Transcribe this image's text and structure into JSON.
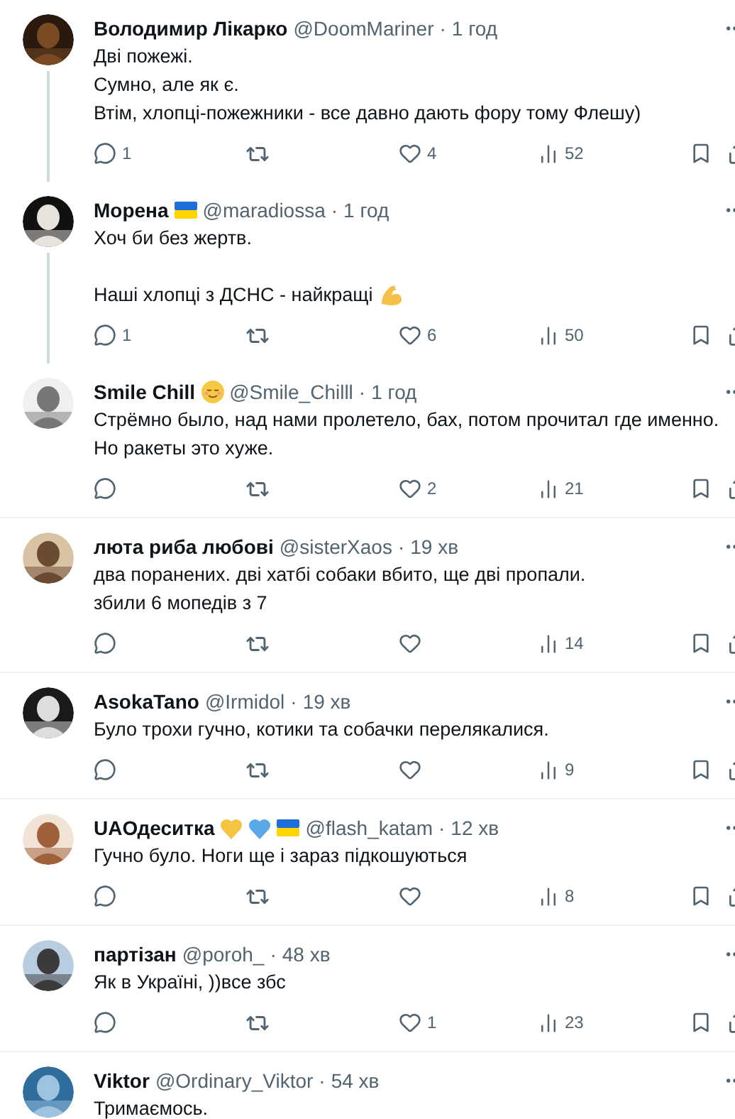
{
  "tweets": [
    {
      "name": "Володимир Лікарко",
      "handle": "@DoomMariner",
      "separator": "·",
      "time": "1 год",
      "thread": true,
      "paragraphs": [
        {
          "kind": "plain",
          "lines": [
            "Дві пожежі.",
            "Сумно, але як є.",
            "Втім, хлопці-пожежники - все давно дають фору тому Флешу)"
          ]
        }
      ],
      "actions": {
        "replies": "1",
        "likes": "4",
        "views": "52"
      }
    },
    {
      "name": "Морена",
      "badges": [
        {
          "kind": "flag"
        }
      ],
      "handle": "@maradiossa",
      "separator": "·",
      "time": "1 год",
      "thread": true,
      "paragraphs": [
        {
          "kind": "plain",
          "lines": [
            "Хоч би без жертв."
          ]
        },
        {
          "kind": "flexed_arm_end",
          "lines": [
            "Наші хлопці з ДСНС - найкращі"
          ]
        }
      ],
      "actions": {
        "replies": "1",
        "likes": "6",
        "views": "50"
      }
    },
    {
      "name": "Smile Chill",
      "badges": [
        {
          "kind": "smile"
        }
      ],
      "handle": "@Smile_Chilll",
      "separator": "·",
      "time": "1 год",
      "thread": false,
      "paragraphs": [
        {
          "kind": "plain",
          "lines": [
            "Стрёмно было, над нами пролетело, бах, потом прочитал где именно.",
            "Но ракеты это хуже."
          ]
        }
      ],
      "actions": {
        "likes": "2",
        "views": "21"
      }
    },
    {
      "name": "люта риба любові",
      "handle": "@sisterXaos",
      "separator": "·",
      "time": "19 хв",
      "thread": false,
      "paragraphs": [
        {
          "kind": "plain",
          "lines": [
            "два поранених. дві хатбі собаки вбито, ще дві пропали.",
            "збили 6 мопедів з 7"
          ]
        }
      ],
      "actions": {
        "views": "14"
      }
    },
    {
      "name": "AsokaTano",
      "handle": "@Irmidol",
      "separator": "·",
      "time": "19 хв",
      "thread": false,
      "paragraphs": [
        {
          "kind": "plain",
          "lines": [
            "Було трохи гучно, котики та собачки перелякалися."
          ]
        }
      ],
      "actions": {
        "views": "9"
      }
    },
    {
      "name": "UAОдеситка",
      "badges": [
        {
          "kind": "heart",
          "color": "#f5c542"
        },
        {
          "kind": "heart",
          "color": "#5aa9e6"
        },
        {
          "kind": "flag"
        }
      ],
      "handle": "@flash_katam",
      "separator": "·",
      "time": "12 хв",
      "thread": false,
      "paragraphs": [
        {
          "kind": "plain",
          "lines": [
            "Гучно було. Ноги ще і зараз підкошуються"
          ]
        }
      ],
      "actions": {
        "views": "8"
      }
    },
    {
      "name": "партізан",
      "handle": "@poroh_",
      "separator": "·",
      "time": "48 хв",
      "thread": false,
      "paragraphs": [
        {
          "kind": "plain",
          "lines": [
            "Як в Україні, ))все збс"
          ]
        }
      ],
      "actions": {
        "likes": "1",
        "views": "23"
      }
    },
    {
      "name": "Viktor",
      "handle": "@Ordinary_Viktor",
      "separator": "·",
      "time": "54 хв",
      "thread": false,
      "paragraphs": [
        {
          "kind": "plain",
          "lines": [
            "Тримаємось."
          ]
        }
      ]
    }
  ]
}
